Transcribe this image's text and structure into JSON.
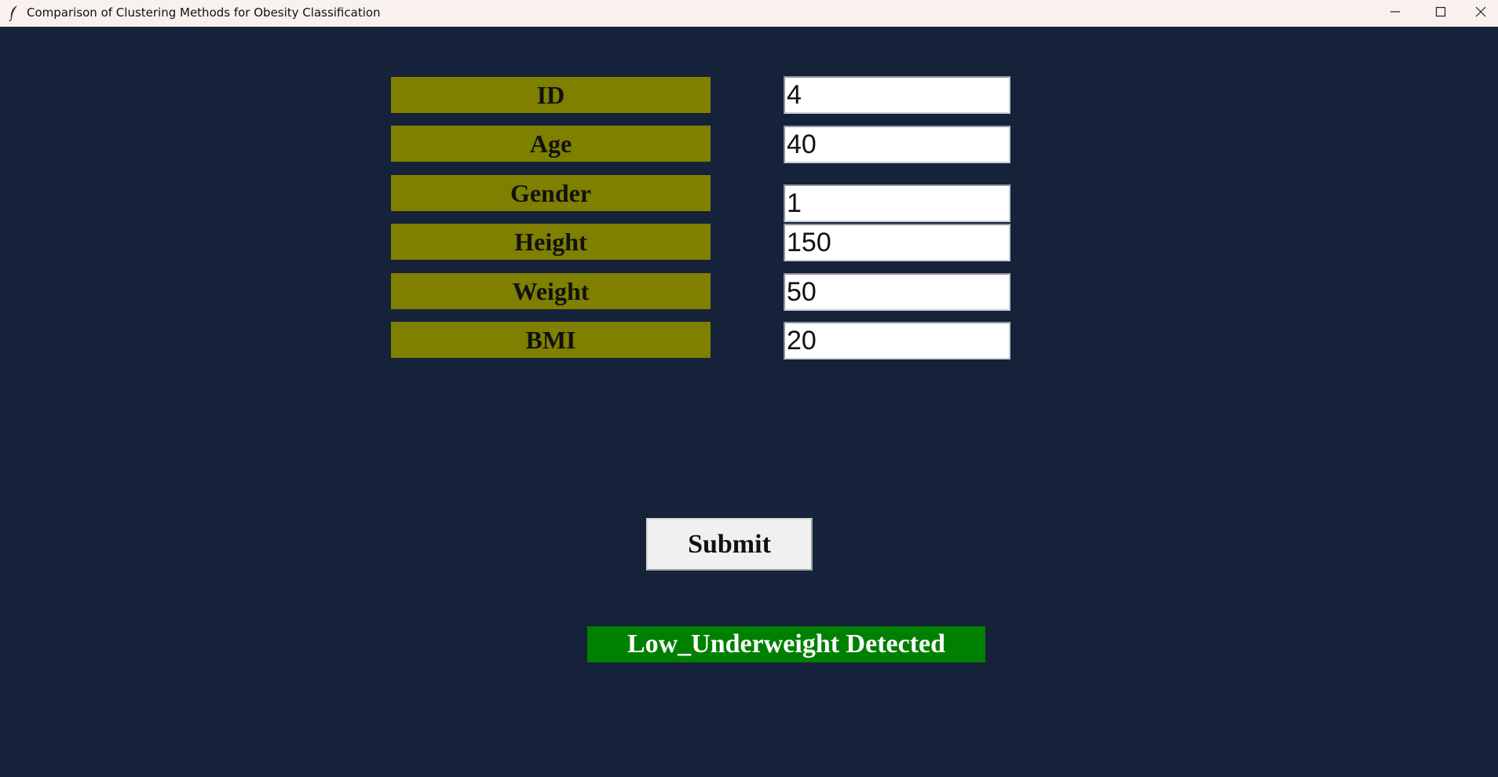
{
  "window": {
    "title": "Comparison of Clustering Methods for Obesity Classification",
    "icon": "feather-icon",
    "controls": [
      "minimize-icon",
      "maximize-icon",
      "close-icon"
    ]
  },
  "form": {
    "fields": [
      {
        "label": "ID",
        "value": "4"
      },
      {
        "label": "Age",
        "value": "40"
      },
      {
        "label": "Gender",
        "value": "1"
      },
      {
        "label": "Height",
        "value": "150"
      },
      {
        "label": "Weight",
        "value": "50"
      },
      {
        "label": "BMI",
        "value": "20"
      }
    ],
    "submit_label": "Submit"
  },
  "result": {
    "text": "Low_Underweight Detected"
  },
  "colors": {
    "background": "#16223a",
    "label_bg": "#7f7f00",
    "result_bg": "#008000",
    "titlebar": "#f9f1ee"
  }
}
